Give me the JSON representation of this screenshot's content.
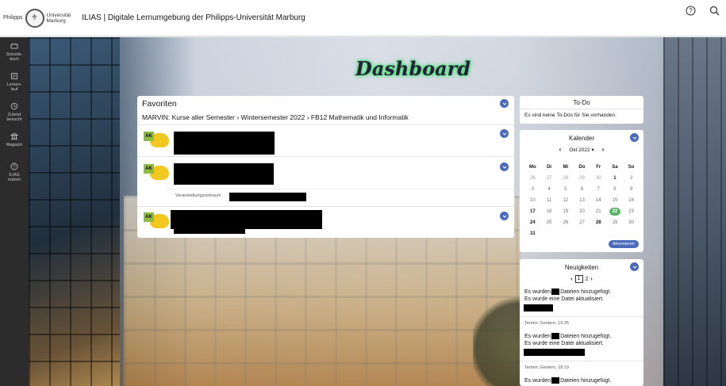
{
  "header": {
    "logo_line1": "Philipps",
    "logo_line2": "Universität",
    "logo_line3": "Marburg",
    "title": "ILIAS | Digitale Lernumgebung der Philipps-Universität Marburg",
    "help_icon": "help-circle-icon",
    "search_icon": "search-icon"
  },
  "sidebar": {
    "items": [
      {
        "label": "Schreib-\ntisch",
        "icon": "desk-icon"
      },
      {
        "label": "Lernen-\nlauf",
        "icon": "learning-icon"
      },
      {
        "label": "Zuletzt\nbesucht",
        "icon": "history-icon"
      },
      {
        "label": "Magazin",
        "icon": "repository-icon"
      },
      {
        "label": "ILIAS\nnutzen",
        "icon": "help-icon"
      }
    ]
  },
  "dashboard": {
    "title": "Dashboard"
  },
  "favoriten": {
    "title": "Favoriten",
    "breadcrumb": "MARVIN: Kurse aller Semester › Wintersemester 2022 › FB12 Mathematik und Informatik",
    "icon_label": "AK",
    "period_label": "Veranstaltungszeitraum"
  },
  "todo": {
    "title": "To-Do",
    "empty_text": "Es sind keine To-Dos für Sie vorhanden."
  },
  "kalender": {
    "title": "Kalender",
    "month": "Okt 2022",
    "weekdays": [
      "Mo",
      "Di",
      "Mi",
      "Do",
      "Fr",
      "Sa",
      "So"
    ],
    "weeks": [
      [
        "26",
        "27",
        "28",
        "29",
        "30",
        "1",
        "2"
      ],
      [
        "3",
        "4",
        "5",
        "6",
        "7",
        "8",
        "9"
      ],
      [
        "10",
        "11",
        "12",
        "13",
        "14",
        "15",
        "16"
      ],
      [
        "17",
        "18",
        "19",
        "20",
        "21",
        "22",
        "23"
      ],
      [
        "24",
        "25",
        "26",
        "27",
        "28",
        "29",
        "30"
      ],
      [
        "31",
        "",
        "",
        "",
        "",
        "",
        ""
      ]
    ],
    "today": "22",
    "subscribe_label": "Abonnieren"
  },
  "neuigkeiten": {
    "title": "Neuigkeiten",
    "page_current": "1",
    "page_next": "2",
    "items": [
      {
        "line1_a": "Es wurden",
        "line1_b": "Dateien hinzugefügt.",
        "line2": "Es wurde eine Datei aktualisiert.",
        "meta": "Termin: Gestern, 19:25"
      },
      {
        "line1_a": "Es wurden",
        "line1_b": "Dateien hinzugefügt.",
        "line2": "Es wurde eine Datei aktualisiert.",
        "meta": "Termin: Gestern, 18:19"
      },
      {
        "line1_a": "Es wurden",
        "line1_b": "Dateien hinzugefügt.",
        "line2": "",
        "meta": ""
      }
    ]
  },
  "colors": {
    "accent": "#4c6aba",
    "today": "#5bb36a",
    "sidebar": "#2c2c2c",
    "glow": "#35e06b"
  }
}
